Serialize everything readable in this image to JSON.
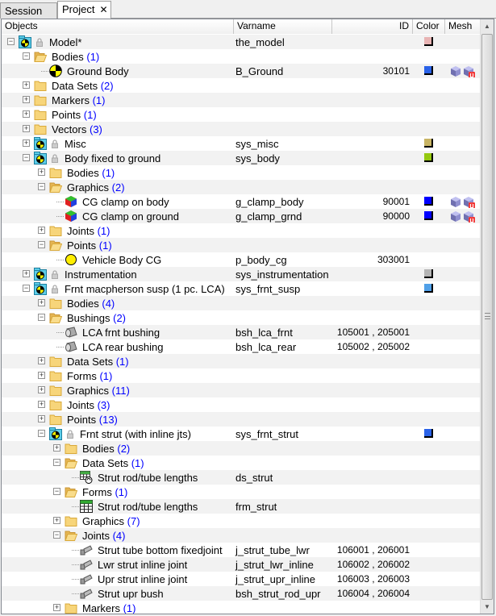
{
  "tabs": [
    {
      "label": "Session",
      "active": false
    },
    {
      "label": "Project",
      "active": true,
      "close": "✕"
    }
  ],
  "columns": {
    "objects": "Objects",
    "varname": "Varname",
    "id": "ID",
    "color": "Color",
    "mesh": "Mesh"
  },
  "rows": [
    {
      "level": 0,
      "exp": "-",
      "icon": "assembly",
      "lock": true,
      "label": "Model*",
      "varname": "the_model",
      "color": "#e8b4b4"
    },
    {
      "level": 1,
      "exp": "-",
      "icon": "folder-open",
      "label": "Bodies",
      "count": "(1)"
    },
    {
      "level": 2,
      "icon": "body",
      "label": "Ground Body",
      "varname": "B_Ground",
      "id": "30101",
      "color": "#2a62e8",
      "mesh": true
    },
    {
      "level": 1,
      "exp": "+",
      "icon": "folder",
      "label": "Data Sets",
      "count": "(2)"
    },
    {
      "level": 1,
      "exp": "+",
      "icon": "folder",
      "label": "Markers",
      "count": "(1)"
    },
    {
      "level": 1,
      "exp": "+",
      "icon": "folder",
      "label": "Points",
      "count": "(1)"
    },
    {
      "level": 1,
      "exp": "+",
      "icon": "folder",
      "label": "Vectors",
      "count": "(3)"
    },
    {
      "level": 1,
      "exp": "+",
      "icon": "assembly",
      "lock": true,
      "label": "Misc",
      "varname": "sys_misc",
      "color": "#c8b464"
    },
    {
      "level": 1,
      "exp": "-",
      "icon": "assembly",
      "lock": true,
      "label": "Body fixed to ground",
      "varname": "sys_body",
      "color": "#94c810"
    },
    {
      "level": 2,
      "exp": "+",
      "icon": "folder",
      "label": "Bodies",
      "count": "(1)"
    },
    {
      "level": 2,
      "exp": "-",
      "icon": "folder-open",
      "label": "Graphics",
      "count": "(2)"
    },
    {
      "level": 3,
      "icon": "graphic",
      "label": "CG clamp on body",
      "varname": "g_clamp_body",
      "id": "90001",
      "color": "#0000ff",
      "mesh": true
    },
    {
      "level": 3,
      "icon": "graphic",
      "label": "CG clamp on ground",
      "varname": "g_clamp_grnd",
      "id": "90000",
      "color": "#0000ff",
      "mesh": true
    },
    {
      "level": 2,
      "exp": "+",
      "icon": "folder",
      "label": "Joints",
      "count": "(1)"
    },
    {
      "level": 2,
      "exp": "-",
      "icon": "folder-open",
      "label": "Points",
      "count": "(1)"
    },
    {
      "level": 3,
      "icon": "point",
      "label": "Vehicle Body CG",
      "varname": "p_body_cg",
      "id": "303001"
    },
    {
      "level": 1,
      "exp": "+",
      "icon": "assembly",
      "lock": true,
      "label": "Instrumentation",
      "varname": "sys_instrumentation",
      "color": "#b4b4b4"
    },
    {
      "level": 1,
      "exp": "-",
      "icon": "assembly",
      "lock": true,
      "label": "Frnt macpherson susp (1 pc. LCA)",
      "varname": "sys_frnt_susp",
      "color": "#50a0e8"
    },
    {
      "level": 2,
      "exp": "+",
      "icon": "folder",
      "label": "Bodies",
      "count": "(4)"
    },
    {
      "level": 2,
      "exp": "-",
      "icon": "folder-open",
      "label": "Bushings",
      "count": "(2)"
    },
    {
      "level": 3,
      "icon": "bushing",
      "label": "LCA frnt bushing",
      "varname": "bsh_lca_frnt",
      "id": "105001 , 205001"
    },
    {
      "level": 3,
      "icon": "bushing",
      "label": "LCA rear bushing",
      "varname": "bsh_lca_rear",
      "id": "105002 , 205002"
    },
    {
      "level": 2,
      "exp": "+",
      "icon": "folder",
      "label": "Data Sets",
      "count": "(1)"
    },
    {
      "level": 2,
      "exp": "+",
      "icon": "folder",
      "label": "Forms",
      "count": "(1)"
    },
    {
      "level": 2,
      "exp": "+",
      "icon": "folder",
      "label": "Graphics",
      "count": "(11)"
    },
    {
      "level": 2,
      "exp": "+",
      "icon": "folder",
      "label": "Joints",
      "count": "(3)"
    },
    {
      "level": 2,
      "exp": "+",
      "icon": "folder",
      "label": "Points",
      "count": "(13)"
    },
    {
      "level": 2,
      "exp": "-",
      "icon": "assembly",
      "lock": true,
      "label": "Frnt strut (with inline jts)",
      "varname": "sys_frnt_strut",
      "color": "#2a62e8"
    },
    {
      "level": 3,
      "exp": "+",
      "icon": "folder",
      "label": "Bodies",
      "count": "(2)"
    },
    {
      "level": 3,
      "exp": "-",
      "icon": "folder-open",
      "label": "Data Sets",
      "count": "(1)"
    },
    {
      "level": 4,
      "icon": "dataset",
      "label": "Strut rod/tube lengths",
      "varname": "ds_strut"
    },
    {
      "level": 3,
      "exp": "-",
      "icon": "folder-open",
      "label": "Forms",
      "count": "(1)"
    },
    {
      "level": 4,
      "icon": "table",
      "label": "Strut rod/tube lengths",
      "varname": "frm_strut"
    },
    {
      "level": 3,
      "exp": "+",
      "icon": "folder",
      "label": "Graphics",
      "count": "(7)"
    },
    {
      "level": 3,
      "exp": "-",
      "icon": "folder-open",
      "label": "Joints",
      "count": "(4)"
    },
    {
      "level": 4,
      "icon": "joint",
      "label": "Strut tube bottom fixedjoint",
      "varname": "j_strut_tube_lwr",
      "id": "106001 , 206001"
    },
    {
      "level": 4,
      "icon": "joint",
      "label": "Lwr strut inline joint",
      "varname": "j_strut_lwr_inline",
      "id": "106002 , 206002"
    },
    {
      "level": 4,
      "icon": "joint",
      "label": "Upr strut inline joint",
      "varname": "j_strut_upr_inline",
      "id": "106003 , 206003"
    },
    {
      "level": 4,
      "icon": "joint",
      "label": "Strut upr bush",
      "varname": "bsh_strut_rod_upr",
      "id": "106004 , 206004"
    },
    {
      "level": 3,
      "exp": "+",
      "icon": "folder",
      "label": "Markers",
      "count": "(1)"
    }
  ]
}
